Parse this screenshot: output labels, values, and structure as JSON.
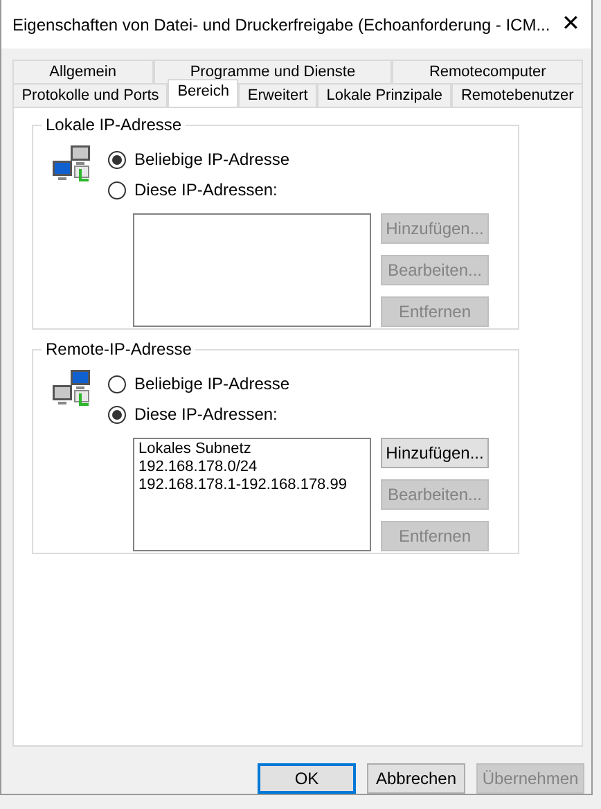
{
  "window": {
    "title": "Eigenschaften von Datei- und Druckerfreigabe (Echoanforderung - ICM...",
    "close": "✕"
  },
  "tab_rows": [
    [
      {
        "label": "Allgemein",
        "selected": false
      },
      {
        "label": "Programme und Dienste",
        "selected": false
      },
      {
        "label": "Remotecomputer",
        "selected": false
      }
    ],
    [
      {
        "label": "Protokolle und Ports",
        "selected": false
      },
      {
        "label": "Bereich",
        "selected": true
      },
      {
        "label": "Erweitert",
        "selected": false
      },
      {
        "label": "Lokale Prinzipale",
        "selected": false
      },
      {
        "label": "Remotebenutzer",
        "selected": false
      }
    ]
  ],
  "groups": [
    {
      "title": "Lokale IP-Adresse",
      "options": [
        {
          "label": "Beliebige IP-Adresse",
          "selected": true
        },
        {
          "label": "Diese IP-Adressen:",
          "selected": false
        }
      ],
      "buttons": [
        {
          "label": "Hinzufügen...",
          "disabled": true
        },
        {
          "label": "Bearbeiten...",
          "disabled": true
        },
        {
          "label": "Entfernen",
          "disabled": true
        }
      ]
    },
    {
      "title": "Remote-IP-Adresse",
      "options": [
        {
          "label": "Beliebige IP-Adresse",
          "selected": false
        },
        {
          "label": "Diese IP-Adressen:",
          "selected": true
        }
      ],
      "addresses": [
        "Lokales Subnetz",
        "192.168.178.0/24",
        "192.168.178.1-192.168.178.99"
      ],
      "buttons": [
        {
          "label": "Hinzufügen...",
          "disabled": false
        },
        {
          "label": "Bearbeiten...",
          "disabled": true
        },
        {
          "label": "Entfernen",
          "disabled": true
        }
      ]
    }
  ],
  "footer_buttons": [
    {
      "label": "OK",
      "default": true,
      "disabled": false
    },
    {
      "label": "Abbrechen",
      "default": false,
      "disabled": false
    },
    {
      "label": "Übernehmen",
      "default": false,
      "disabled": true
    }
  ]
}
